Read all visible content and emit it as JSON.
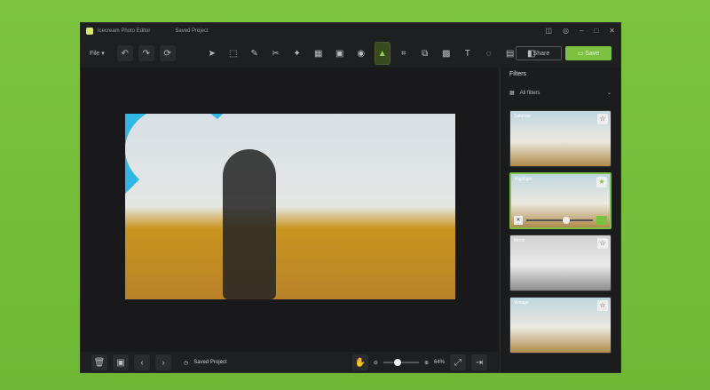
{
  "app": {
    "title": "Icecream Photo Editor",
    "project": "Saved Project"
  },
  "toolbar": {
    "file": "File",
    "share": "Share",
    "save": "Save",
    "tools": [
      "select",
      "marquee",
      "brush",
      "heal",
      "retouch",
      "collage",
      "frame",
      "blur",
      "filters",
      "crop",
      "resize",
      "watermark",
      "text",
      "color",
      "stickers",
      "compare"
    ]
  },
  "filters": {
    "title": "Filters",
    "category": "All filters",
    "items": [
      {
        "label": "Saturate"
      },
      {
        "label": "Highlight"
      },
      {
        "label": "Mono"
      },
      {
        "label": "Vintage"
      }
    ]
  },
  "bottom": {
    "project_name": "Saved Project",
    "zoom": "64%"
  },
  "colors": {
    "accent": "#7dc141",
    "bg": "#1e1f21"
  }
}
